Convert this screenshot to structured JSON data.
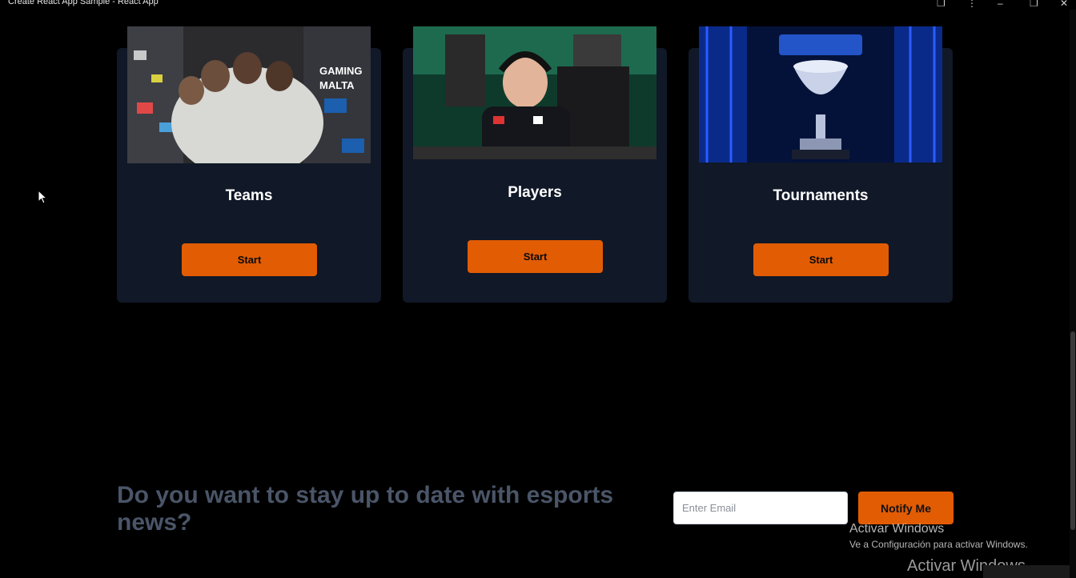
{
  "window": {
    "title": "Create React App Sample - React App"
  },
  "cards": [
    {
      "title": "Teams",
      "button_label": "Start"
    },
    {
      "title": "Players",
      "button_label": "Start"
    },
    {
      "title": "Tournaments",
      "button_label": "Start"
    }
  ],
  "newsletter": {
    "heading": "Do you want to stay up to date with esports news?",
    "email_placeholder": "Enter Email",
    "button_label": "Notify Me"
  },
  "watermark": {
    "line1": "Activar Windows",
    "line2": "Ve a Configuración para activar Windows.",
    "line3": "Activar Windows"
  },
  "colors": {
    "page_bg": "#000000",
    "card_bg": "#111827",
    "accent": "#e25c04",
    "heading_muted": "#4a5568"
  }
}
